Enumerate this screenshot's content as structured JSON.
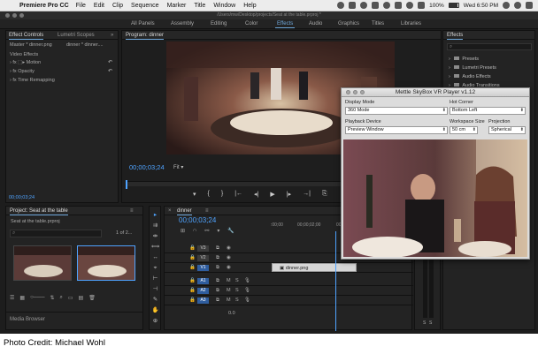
{
  "menubar": {
    "app": "Premiere Pro CC",
    "items": [
      "File",
      "Edit",
      "Clip",
      "Sequence",
      "Marker",
      "Title",
      "Window",
      "Help"
    ],
    "battery": "100%",
    "clock": "Wed 6:50 PM"
  },
  "titlebar": {
    "path": "/Users/mw/Desktop/projects/Seat at the table.prproj *"
  },
  "workspaces": [
    "All Panels",
    "Assembly",
    "Editing",
    "Color",
    "Effects",
    "Audio",
    "Graphics",
    "Titles",
    "Libraries"
  ],
  "effect_controls": {
    "tabs": [
      "Effect Controls",
      "Lumetri Scopes"
    ],
    "master": "Master * dinner.png",
    "clip": "dinner * dinner....",
    "section": "Video Effects",
    "rows": [
      "Motion",
      "Opacity",
      "Time Remapping"
    ],
    "timecode": "00;00;03;24"
  },
  "program": {
    "title": "Program: dinner",
    "timecode": "00;00;03;24",
    "fit": "Fit",
    "controls": [
      "▾",
      "{",
      "}",
      "|←",
      "◂|",
      "▶",
      "|▸",
      "→|",
      "⎘"
    ]
  },
  "effects_panel": {
    "title": "Effects",
    "search_placeholder": "",
    "items": [
      "Presets",
      "Lumetri Presets",
      "Audio Effects",
      "Audio Transitions"
    ]
  },
  "project": {
    "title": "Project: Seat at the table",
    "file": "Seat at the table.prproj",
    "count": "1 of 2...",
    "media_browser": "Media Browser"
  },
  "timeline": {
    "title": "dinner",
    "timecode": "00;00;03;24",
    "ruler": [
      ":00;00",
      "00;00;02;00",
      "00;00"
    ],
    "tracks": [
      "V3",
      "V2",
      "V1",
      "A1",
      "A2",
      "A3"
    ],
    "clip": "dinner.png",
    "volume": "0.0"
  },
  "skybox": {
    "title": "Mettle SkyBox VR Player v1.12",
    "display_mode_label": "Display Mode",
    "display_mode": "360 Mode",
    "hotcorner_label": "Hot Corner",
    "hotcorner": "Bottom Left",
    "playback_label": "Playback Device",
    "playback": "Preview Window",
    "workspace_label": "Workspace Size",
    "workspace": "50 cm",
    "projection_label": "Projection",
    "projection": "Spherical"
  },
  "credit": "Photo Credit: Michael Wohl"
}
